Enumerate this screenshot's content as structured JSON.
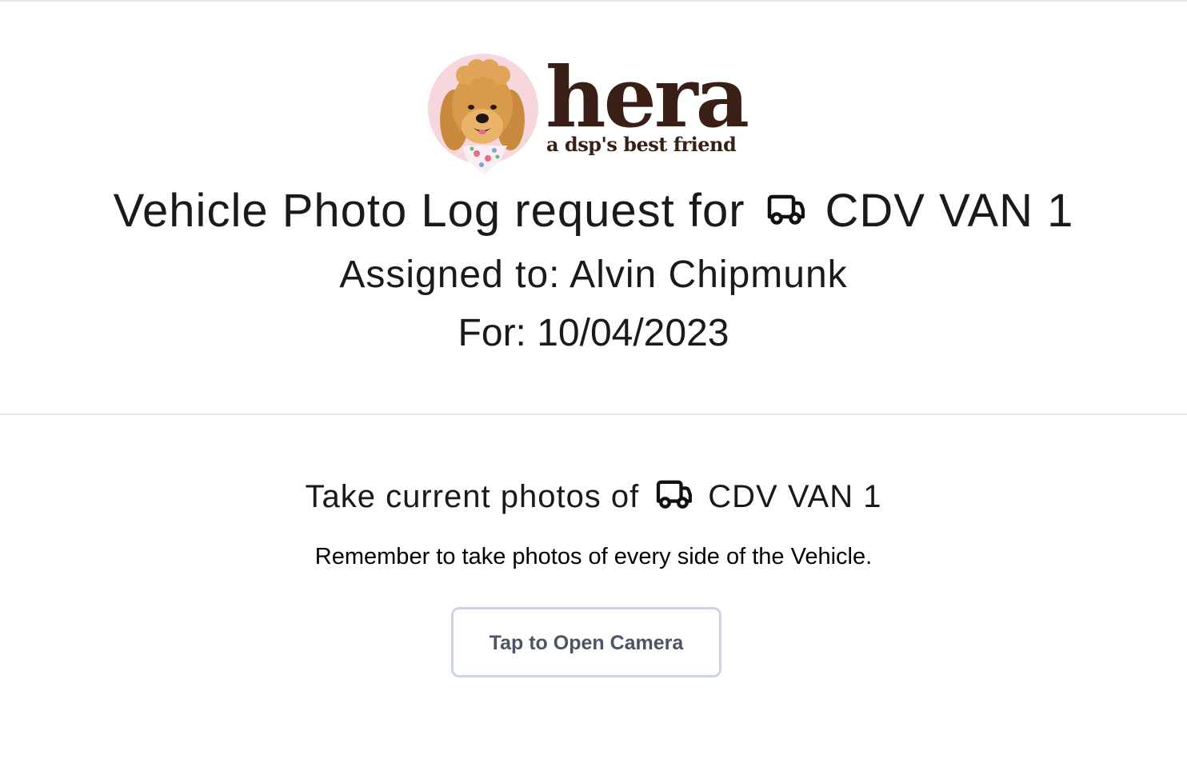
{
  "logo": {
    "wordmark": "hera",
    "tagline": "a dsp's best friend",
    "dog_icon": "goldendoodle-mascot-icon"
  },
  "header": {
    "request_prefix": "Vehicle Photo Log request for",
    "vehicle_icon": "truck-icon",
    "vehicle_name": "CDV VAN 1",
    "assigned_to": "Assigned to: Alvin Chipmunk",
    "for_date": "For: 10/04/2023"
  },
  "photo_section": {
    "prompt_prefix": "Take current photos of",
    "vehicle_icon": "truck-icon",
    "vehicle_name": "CDV VAN 1",
    "reminder": "Remember to take photos of every side of the Vehicle.",
    "camera_button_label": "Tap to Open Camera"
  },
  "colors": {
    "brand_brown": "#3a1f17",
    "logo_circle_pink": "#f7d6dc",
    "button_border": "#cbd5e1",
    "button_text": "#4b5563",
    "divider": "#e5e7eb"
  }
}
